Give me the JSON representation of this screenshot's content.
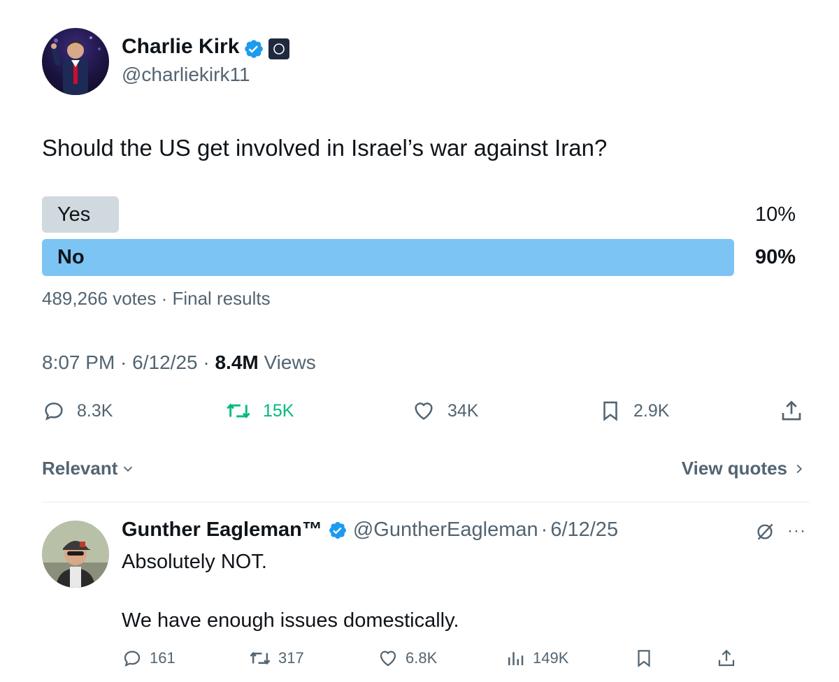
{
  "tweet": {
    "author_name": "Charlie Kirk",
    "author_handle": "@charliekirk11",
    "verified_color": "#1d9bf0",
    "text": "Should the US get involved in Israel’s war against Iran?",
    "poll": {
      "options": [
        {
          "label": "Yes",
          "percent_text": "10%",
          "percent": 10
        },
        {
          "label": "No",
          "percent_text": "90%",
          "percent": 90
        }
      ],
      "votes": "489,266 votes",
      "status": "Final results",
      "meta_separator": " · "
    },
    "time": "8:07 PM",
    "date": "6/12/25",
    "views_count": "8.4M",
    "views_label": "Views",
    "actions": {
      "replies": "8.3K",
      "reposts": "15K",
      "likes": "34K",
      "bookmarks": "2.9K"
    }
  },
  "sort": {
    "label": "Relevant",
    "view_quotes": "View quotes"
  },
  "reply": {
    "author_name": "Gunther Eagleman™",
    "author_handle": "@GuntherEagleman",
    "date": "6/12/25",
    "line1": "Absolutely NOT.",
    "line2": "We have enough issues domestically.",
    "actions": {
      "replies": "161",
      "reposts": "317",
      "likes": "6.8K",
      "views": "149K"
    }
  },
  "colors": {
    "accent": "#1d9bf0",
    "repost_green": "#00ba7c",
    "poll_winner": "#7cc4f4",
    "poll_other": "#cfd9de",
    "secondary_text": "#536471"
  }
}
